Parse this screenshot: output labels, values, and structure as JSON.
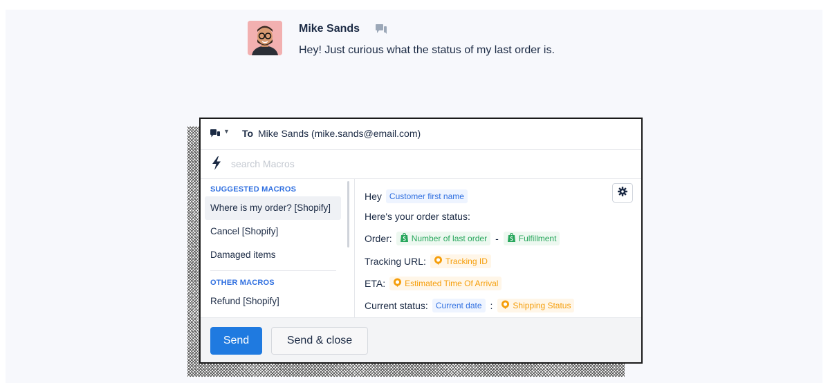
{
  "message": {
    "author": "Mike Sands",
    "text": "Hey! Just curious what the status of my last order is."
  },
  "composer": {
    "to_label": "To",
    "recipient": "Mike Sands (mike.sands@email.com)",
    "search_placeholder": "search Macros"
  },
  "macros": {
    "suggested_title": "SUGGESTED MACROS",
    "suggested": [
      "Where is my order? [Shopify]",
      "Cancel [Shopify]",
      "Damaged items"
    ],
    "other_title": "OTHER MACROS",
    "other": [
      "Refund [Shopify]"
    ]
  },
  "preview": {
    "greeting": "Hey",
    "customer_var": "Customer first name",
    "line2": "Here's your order status:",
    "order_label": "Order:",
    "order_var": "Number of last order",
    "dash": "-",
    "fulfillment_var": "Fulfillment",
    "tracking_label": "Tracking URL:",
    "tracking_var": "Tracking ID",
    "eta_label": "ETA:",
    "eta_var": "Estimated Time Of Arrival",
    "status_label": "Current status:",
    "date_var": "Current date",
    "colon": ":",
    "shipping_var": "Shipping Status"
  },
  "footer": {
    "send": "Send",
    "send_close": "Send & close"
  },
  "colors": {
    "accent": "#1f7ae0",
    "variable_blue": "#2f6fe0",
    "shopify_green": "#26a65b",
    "tracking_orange": "#f59e0b"
  },
  "icons": [
    "chat-icon",
    "caret-down-icon",
    "bolt-icon",
    "gear-icon",
    "shopify-icon",
    "tracking-icon"
  ]
}
